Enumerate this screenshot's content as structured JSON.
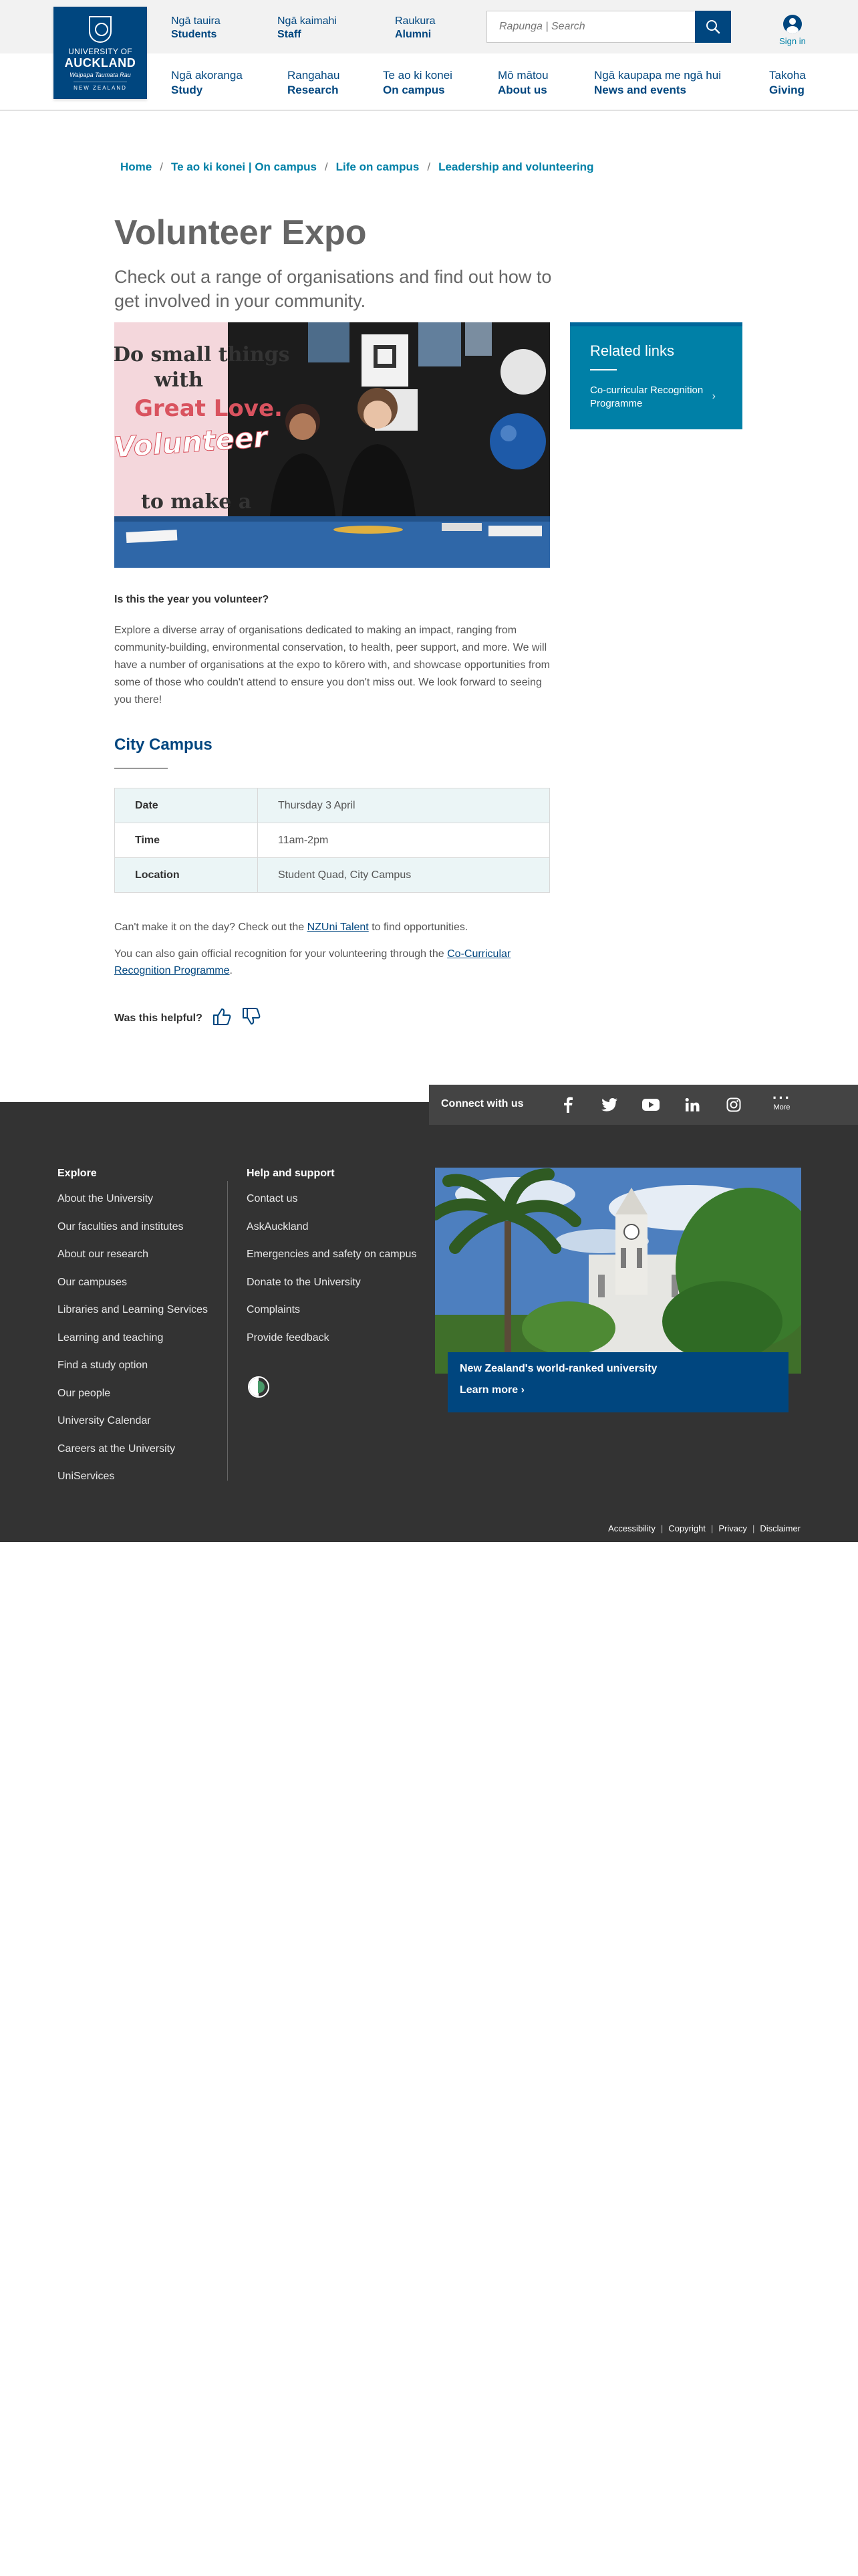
{
  "header": {
    "logo": {
      "line1": "UNIVERSITY OF",
      "line2": "AUCKLAND",
      "line3": "Waipapa Taumata Rau",
      "line4": "NEW ZEALAND"
    },
    "top_links": [
      {
        "maori": "Ngā tauira",
        "english": "Students"
      },
      {
        "maori": "Ngā kaimahi",
        "english": "Staff"
      },
      {
        "maori": "Raukura",
        "english": "Alumni"
      }
    ],
    "search": {
      "placeholder": "Rapunga | Search",
      "icon": "search-icon"
    },
    "sign_in": {
      "label": "Sign in",
      "icon": "user-icon"
    },
    "nav": [
      {
        "maori": "Ngā akoranga",
        "english": "Study"
      },
      {
        "maori": "Rangahau",
        "english": "Research"
      },
      {
        "maori": "Te ao ki konei",
        "english": "On campus"
      },
      {
        "maori": "Mō mātou",
        "english": "About us"
      },
      {
        "maori": "Ngā kaupapa me ngā hui",
        "english": "News and events"
      },
      {
        "maori": "Takoha",
        "english": "Giving"
      }
    ]
  },
  "breadcrumb": [
    "Home",
    "Te ao ki konei | On campus",
    "Life on campus",
    "Leadership and volunteering"
  ],
  "page": {
    "title": "Volunteer Expo",
    "lede": "Check out a range of organisations and find out how to get involved in your community.",
    "hero_image_text": {
      "line1": "Do small things",
      "line2": "with",
      "line3": "Great Love.",
      "line4": "Volunteer",
      "line5": "to make a"
    },
    "question": "Is this the year you volunteer?",
    "paragraph": "Explore a diverse array of organisations dedicated to making an impact, ranging from community-building, environmental conservation, to health, peer support, and more. We will have a number of organisations at the expo to kōrero with, and showcase opportunities from some of those who couldn't attend to ensure you don't miss out. We look forward to seeing you there!",
    "section_heading": "City Campus",
    "details": [
      {
        "label": "Date",
        "value": "Thursday 3 April"
      },
      {
        "label": "Time",
        "value": "11am-2pm"
      },
      {
        "label": "Location",
        "value": "Student Quad, City Campus"
      }
    ],
    "note1_before": "Can't make it on the day?  Check out the ",
    "note1_link": "NZUni Talent",
    "note1_after": " to find opportunities.",
    "note2_before": "You can also gain official recognition for your volunteering through the ",
    "note2_link": "Co-Curricular Recognition Programme",
    "note2_after": ".",
    "helpful": "Was this helpful?"
  },
  "related": {
    "heading": "Related links",
    "links": [
      "Co-curricular Recognition Programme"
    ]
  },
  "footer": {
    "connect_label": "Connect with us",
    "social_icons": [
      "facebook-icon",
      "twitter-icon",
      "youtube-icon",
      "linkedin-icon",
      "instagram-icon"
    ],
    "more_label": "More",
    "explore_heading": "Explore",
    "explore_links": [
      "About the University",
      "Our faculties and institutes",
      "About our research",
      "Our campuses",
      "Libraries and Learning Services",
      "Learning and teaching",
      "Find a study option",
      "Our people",
      "University Calendar",
      "Careers at the University",
      "UniServices"
    ],
    "help_heading": "Help and support",
    "help_links": [
      "Contact us",
      "AskAuckland",
      "Emergencies and safety on campus",
      "Donate to the University",
      "Complaints",
      "Provide feedback"
    ],
    "card_title": "New Zealand's world-ranked university",
    "card_link": "Learn more",
    "legal": [
      "Accessibility",
      "Copyright",
      "Privacy",
      "Disclaimer"
    ]
  },
  "colors": {
    "brand_navy": "#00467f",
    "accent_teal": "#0080a7",
    "footer_bg": "#333333",
    "table_alt": "#ebf5f6"
  }
}
